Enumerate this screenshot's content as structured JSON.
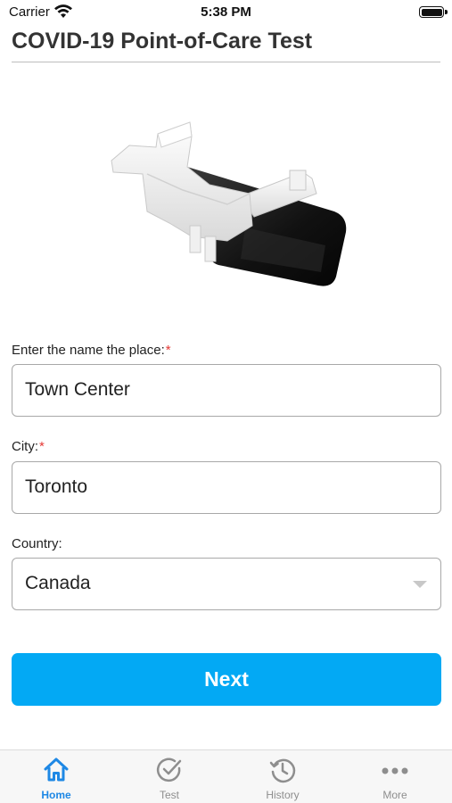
{
  "status_bar": {
    "carrier": "Carrier",
    "time": "5:38 PM"
  },
  "header": {
    "title": "COVID-19 Point-of-Care Test"
  },
  "form": {
    "place": {
      "label": "Enter the name the place:",
      "required_mark": "*",
      "value": "Town Center"
    },
    "city": {
      "label": "City:",
      "required_mark": "*",
      "value": "Toronto"
    },
    "country": {
      "label": "Country:",
      "value": "Canada"
    }
  },
  "next_button": {
    "label": "Next"
  },
  "tab_bar": {
    "active_color": "#1e88e5",
    "inactive_color": "#8e8e8e",
    "items": [
      {
        "label": "Home",
        "icon": "home-icon",
        "active": true
      },
      {
        "label": "Test",
        "icon": "check-circle-icon",
        "active": false
      },
      {
        "label": "History",
        "icon": "history-icon",
        "active": false
      },
      {
        "label": "More",
        "icon": "more-icon",
        "active": false
      }
    ]
  },
  "colors": {
    "accent": "#03a9f4",
    "required": "#e53935"
  }
}
